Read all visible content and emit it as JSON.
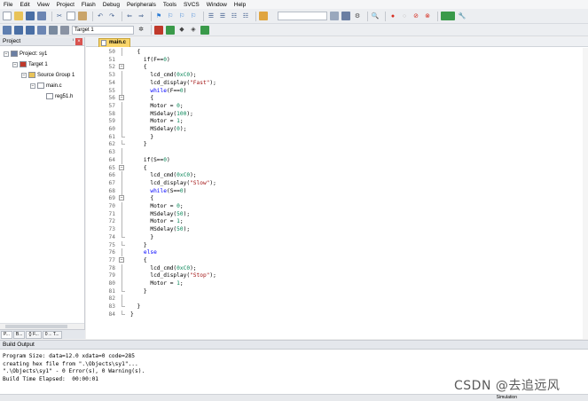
{
  "menu": [
    "File",
    "Edit",
    "View",
    "Project",
    "Flash",
    "Debug",
    "Peripherals",
    "Tools",
    "SVCS",
    "Window",
    "Help"
  ],
  "toolbar": {
    "target": "Target 1",
    "icons": [
      "new-file-icon",
      "open-folder-icon",
      "save-icon",
      "save-all-icon",
      "cut-icon",
      "copy-icon",
      "paste-icon",
      "undo-icon",
      "redo-icon",
      "nav-back-icon",
      "nav-forward-icon",
      "bookmark-icon",
      "bookmark-prev-icon",
      "bookmark-next-icon",
      "bookmark-clear-icon",
      "indent-icon",
      "unindent-icon",
      "comment-icon",
      "uncomment-icon",
      "find-in-files-icon"
    ]
  },
  "project_panel": {
    "title": "Project",
    "pin": "ⁱ",
    "close": "×",
    "tree": [
      {
        "label": "Project: sy1",
        "level": 0,
        "expand": "−",
        "icon": "project-icon"
      },
      {
        "label": "Target 1",
        "level": 1,
        "expand": "−",
        "icon": "target-icon"
      },
      {
        "label": "Source Group 1",
        "level": 2,
        "expand": "−",
        "icon": "folder-icon"
      },
      {
        "label": "main.c",
        "level": 3,
        "expand": "−",
        "icon": "file-icon"
      },
      {
        "label": "reg51.h",
        "level": 4,
        "expand": "",
        "icon": "header-file-icon"
      }
    ],
    "tabs": [
      "P...",
      "B...",
      "{} F...",
      "0→ T..."
    ]
  },
  "editor": {
    "active_tab": "main.c",
    "lines": [
      {
        "n": "50",
        "f": "line",
        "code": [
          [
            "  {",
            ""
          ]
        ]
      },
      {
        "n": "51",
        "f": "",
        "code": [
          [
            "    if(F==",
            ""
          ],
          [
            "0",
            "num"
          ],
          [
            ")",
            ""
          ]
        ]
      },
      {
        "n": "52",
        "f": "open",
        "code": [
          [
            "    {",
            ""
          ]
        ]
      },
      {
        "n": "53",
        "f": "line",
        "code": [
          [
            "      lcd_cmd(",
            ""
          ],
          [
            "0xC0",
            "num"
          ],
          [
            ");",
            ""
          ]
        ]
      },
      {
        "n": "54",
        "f": "line",
        "code": [
          [
            "      lcd_display(",
            ""
          ],
          [
            "\"Fast\"",
            "str"
          ],
          [
            ");",
            ""
          ]
        ]
      },
      {
        "n": "55",
        "f": "line",
        "code": [
          [
            "      ",
            ""
          ],
          [
            "while",
            "kw"
          ],
          [
            "(F==",
            ""
          ],
          [
            "0",
            "num"
          ],
          [
            ")",
            ""
          ]
        ]
      },
      {
        "n": "56",
        "f": "open",
        "code": [
          [
            "      {",
            ""
          ]
        ]
      },
      {
        "n": "57",
        "f": "line",
        "code": [
          [
            "      Motor = ",
            ""
          ],
          [
            "0",
            "num"
          ],
          [
            ";",
            ""
          ]
        ]
      },
      {
        "n": "58",
        "f": "line",
        "code": [
          [
            "      MSdelay(",
            ""
          ],
          [
            "100",
            "num"
          ],
          [
            ");",
            ""
          ]
        ]
      },
      {
        "n": "59",
        "f": "line",
        "code": [
          [
            "      Motor = ",
            ""
          ],
          [
            "1",
            "num"
          ],
          [
            ";",
            ""
          ]
        ]
      },
      {
        "n": "60",
        "f": "line",
        "code": [
          [
            "      MSdelay(",
            ""
          ],
          [
            "0",
            "num"
          ],
          [
            ");",
            ""
          ]
        ]
      },
      {
        "n": "61",
        "f": "end",
        "code": [
          [
            "      }",
            ""
          ]
        ]
      },
      {
        "n": "62",
        "f": "end",
        "code": [
          [
            "    }",
            ""
          ]
        ]
      },
      {
        "n": "63",
        "f": "line",
        "code": [
          [
            "",
            ""
          ]
        ]
      },
      {
        "n": "64",
        "f": "line",
        "code": [
          [
            "    if(S==",
            ""
          ],
          [
            "0",
            "num"
          ],
          [
            ")",
            ""
          ]
        ]
      },
      {
        "n": "65",
        "f": "open",
        "code": [
          [
            "    {",
            ""
          ]
        ]
      },
      {
        "n": "66",
        "f": "line",
        "code": [
          [
            "      lcd_cmd(",
            ""
          ],
          [
            "0xC0",
            "num"
          ],
          [
            ");",
            ""
          ]
        ]
      },
      {
        "n": "67",
        "f": "line",
        "code": [
          [
            "      lcd_display(",
            ""
          ],
          [
            "\"Slow\"",
            "str"
          ],
          [
            ");",
            ""
          ]
        ]
      },
      {
        "n": "68",
        "f": "line",
        "code": [
          [
            "      ",
            ""
          ],
          [
            "while",
            "kw"
          ],
          [
            "(S==",
            ""
          ],
          [
            "0",
            "num"
          ],
          [
            ")",
            ""
          ]
        ]
      },
      {
        "n": "69",
        "f": "open",
        "code": [
          [
            "      {",
            ""
          ]
        ]
      },
      {
        "n": "70",
        "f": "line",
        "code": [
          [
            "      Motor = ",
            ""
          ],
          [
            "0",
            "num"
          ],
          [
            ";",
            ""
          ]
        ]
      },
      {
        "n": "71",
        "f": "line",
        "code": [
          [
            "      MSdelay(",
            ""
          ],
          [
            "50",
            "num"
          ],
          [
            ");",
            ""
          ]
        ]
      },
      {
        "n": "72",
        "f": "line",
        "code": [
          [
            "      Motor = ",
            ""
          ],
          [
            "1",
            "num"
          ],
          [
            ";",
            ""
          ]
        ]
      },
      {
        "n": "73",
        "f": "line",
        "code": [
          [
            "      MSdelay(",
            ""
          ],
          [
            "50",
            "num"
          ],
          [
            ");",
            ""
          ]
        ]
      },
      {
        "n": "74",
        "f": "end",
        "code": [
          [
            "      }",
            ""
          ]
        ]
      },
      {
        "n": "75",
        "f": "end",
        "code": [
          [
            "    }",
            ""
          ]
        ]
      },
      {
        "n": "76",
        "f": "line",
        "code": [
          [
            "    ",
            ""
          ],
          [
            "else",
            "kw"
          ]
        ]
      },
      {
        "n": "77",
        "f": "open",
        "code": [
          [
            "    {",
            ""
          ]
        ]
      },
      {
        "n": "78",
        "f": "line",
        "code": [
          [
            "      lcd_cmd(",
            ""
          ],
          [
            "0xC0",
            "num"
          ],
          [
            ");",
            ""
          ]
        ]
      },
      {
        "n": "79",
        "f": "line",
        "code": [
          [
            "      lcd_display(",
            ""
          ],
          [
            "\"Stop\"",
            "str"
          ],
          [
            ");",
            ""
          ]
        ]
      },
      {
        "n": "80",
        "f": "line",
        "code": [
          [
            "      Motor = ",
            ""
          ],
          [
            "1",
            "num"
          ],
          [
            ";",
            ""
          ]
        ]
      },
      {
        "n": "81",
        "f": "end",
        "code": [
          [
            "    }",
            ""
          ]
        ]
      },
      {
        "n": "82",
        "f": "line",
        "code": [
          [
            "",
            ""
          ]
        ]
      },
      {
        "n": "83",
        "f": "end",
        "code": [
          [
            "  }",
            ""
          ]
        ]
      },
      {
        "n": "84",
        "f": "end",
        "code": [
          [
            "}",
            ""
          ]
        ]
      }
    ]
  },
  "build_output": {
    "title": "Build Output",
    "lines": [
      "Program Size: data=12.0 xdata=0 code=285",
      "creating hex file from \".\\Objects\\sy1\"...",
      "\".\\Objects\\sy1\" - 0 Error(s), 0 Warning(s).",
      "Build Time Elapsed:  00:00:01"
    ]
  },
  "statusbar": {
    "mode": "Simulation"
  },
  "watermark": "CSDN @去追远风"
}
